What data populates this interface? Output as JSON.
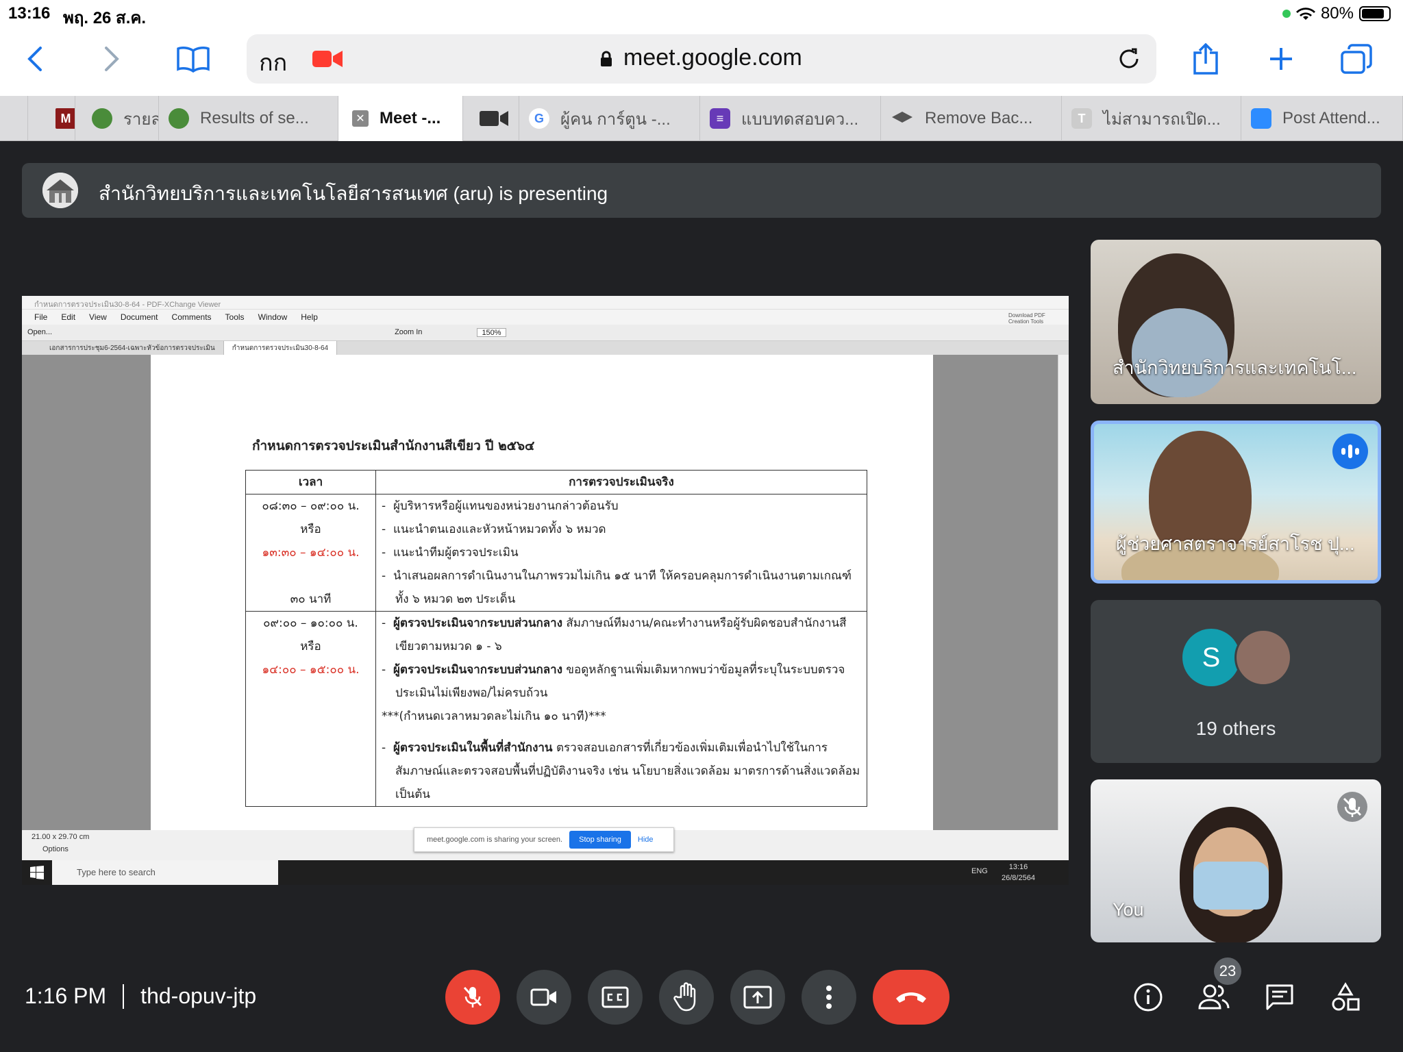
{
  "status": {
    "time": "13:16",
    "date": "พฤ. 26 ส.ค.",
    "battery": "80%"
  },
  "browser": {
    "aa_label": "กก",
    "url": "meet.google.com",
    "tabs": [
      {
        "label": "",
        "icon_text": "M",
        "color": "#8b1a1a"
      },
      {
        "label": "รายล",
        "icon_text": "",
        "color": "#4a8c3a"
      },
      {
        "label": "Results of se...",
        "icon_text": "",
        "color": "#4a8c3a"
      },
      {
        "label": "Meet -...",
        "icon_text": "✕",
        "color": "#888888"
      },
      {
        "label": "",
        "icon_text": "",
        "color": "#333333"
      },
      {
        "label": "ผู้คน การ์ตูน -...",
        "icon_text": "G",
        "color": "#ffffff"
      },
      {
        "label": "แบบทดสอบคว...",
        "icon_text": "≡",
        "color": "#673ab7"
      },
      {
        "label": "Remove Bac...",
        "icon_text": "",
        "color": "#555555"
      },
      {
        "label": "ไม่สามารถเปิด...",
        "icon_text": "T",
        "color": "#cccccc"
      },
      {
        "label": "Post Attend...",
        "icon_text": "",
        "color": "#2d8cff"
      }
    ]
  },
  "banner": {
    "text": "สำนักวิทยบริการและเทคโนโลยีสารสนเทศ (aru) is presenting"
  },
  "shared": {
    "window_title": "กำหนดการตรวจประเมิน30-8-64 - PDF-XChange Viewer",
    "menu": [
      "File",
      "Edit",
      "View",
      "Document",
      "Comments",
      "Tools",
      "Window",
      "Help"
    ],
    "tools": [
      "Open...",
      "Zoom In",
      "150%"
    ],
    "download_label": "Download PDF Creation Tools",
    "doc_tabs": [
      "เอกสารการประชุม6-2564-เฉพาะหัวข้อการตรวจประเมิน",
      "กำหนดการตรวจประเมิน30-8-64"
    ],
    "doc_title": "กำหนดการตรวจประเมินสำนักงานสีเขียว ปี ๒๕๖๔",
    "col_time": "เวลา",
    "col_activity": "การตรวจประเมินจริง",
    "row1": {
      "t1": "๐๘:๓๐ – ๐๙:๐๐ น.",
      "or1": "หรือ",
      "t2": "๑๓:๓๐ – ๑๔:๐๐ น.",
      "dur": "๓๐ นาที",
      "items": [
        "ผู้บริหารหรือผู้แทนของหน่วยงานกล่าวต้อนรับ",
        "แนะนำตนเองและหัวหน้าหมวดทั้ง ๖ หมวด",
        "แนะนำทีมผู้ตรวจประเมิน",
        "นำเสนอผลการดำเนินงานในภาพรวมไม่เกิน ๑๕ นาที ให้ครอบคลุมการดำเนินงานตามเกณฑ์ทั้ง ๖ หมวด ๒๓ ประเด็น"
      ]
    },
    "row2": {
      "t1": "๐๙:๐๐ – ๑๐:๐๐ น.",
      "or1": "หรือ",
      "t2": "๑๔:๐๐ – ๑๕:๐๐ น.",
      "i1_bold": "ผู้ตรวจประเมินจากระบบส่วนกลาง",
      "i1_rest": " สัมภาษณ์ทีมงาน/คณะทำงานหรือผู้รับผิดชอบสำนักงานสีเขียวตามหมวด ๑ - ๖",
      "i2_bold": "ผู้ตรวจประเมินจากระบบส่วนกลาง",
      "i2_rest": " ขอดูหลักฐานเพิ่มเติมหากพบว่าข้อมูลที่ระบุในระบบตรวจประเมินไม่เพียงพอ/ไม่ครบถ้วน",
      "note": "***(กำหนดเวลาหมวดละไม่เกิน ๑๐ นาที)***",
      "i3_bold": "ผู้ตรวจประเมินในพื้นที่สำนักงาน",
      "i3_rest": " ตรวจสอบเอกสารที่เกี่ยวข้องเพิ่มเติมเพื่อนำไปใช้ในการสัมภาษณ์และตรวจสอบพื้นที่ปฏิบัติงานจริง เช่น นโยบายสิ่งแวดล้อม มาตรการด้านสิ่งแวดล้อม เป็นต้น"
    },
    "page_size": "21.00 x 29.70 cm",
    "options": "Options",
    "sharing_text": "meet.google.com is sharing your screen.",
    "stop_sharing": "Stop sharing",
    "hide": "Hide",
    "search_placeholder": "Type here to search",
    "lang": "ENG",
    "clock_time": "13:16",
    "clock_date": "26/8/2564"
  },
  "participants": {
    "p1": "สำนักวิทยบริการและเทคโนโ...",
    "p2": "ผู้ช่วยศาสตราจารย์สาโรช ปุ...",
    "others_initial": "S",
    "others": "19 others",
    "you": "You"
  },
  "meeting": {
    "time": "1:16 PM",
    "code": "thd-opuv-jtp",
    "people_count": "23"
  }
}
